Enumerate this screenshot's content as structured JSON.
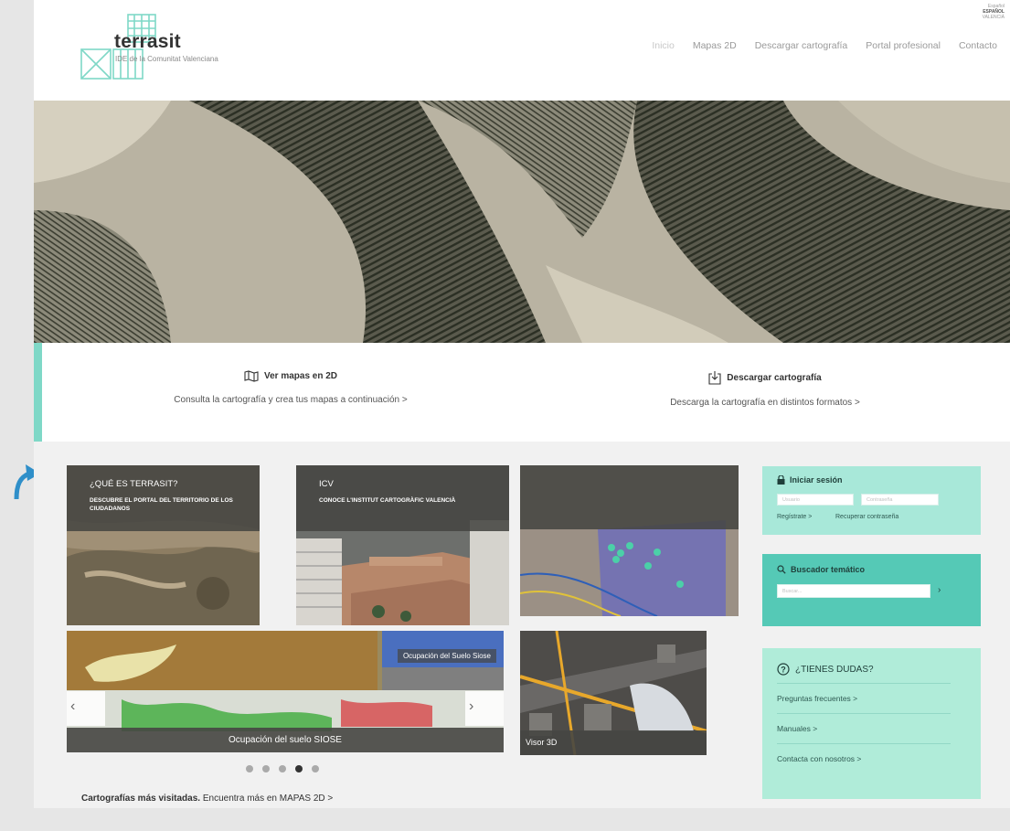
{
  "lang": {
    "l1": "Español",
    "l2": "ESPAÑOL",
    "l3": "VALENCIÀ"
  },
  "logo": {
    "name": "terrasit",
    "sub": "IDE de la Comunitat Valenciana"
  },
  "nav": [
    "Inicio",
    "Mapas 2D",
    "Descargar cartografía",
    "Portal profesional",
    "Contacto"
  ],
  "quick": {
    "maps_title": "Ver mapas en 2D",
    "maps_desc": "Consulta la cartografía y crea tus mapas a continuación >",
    "dl_title": "Descargar cartografía",
    "dl_desc": "Descarga la cartografía en distintos formatos >"
  },
  "tiles": {
    "t1_head": "¿QUÉ ES TERRASIT?",
    "t1_sub": "DESCUBRE EL PORTAL DEL TERRITORIO DE LOS CIUDADANOS",
    "t2_head": "ICV",
    "t2_sub": "CONOCE L'INSTITUT CARTOGRÀFIC VALENCIÀ",
    "carousel_label": "Ocupación del Suelo Siose",
    "carousel_caption": "Ocupación del suelo SIOSE",
    "visor3d": "Visor 3D"
  },
  "dots": {
    "count": 5,
    "active_index": 3
  },
  "bottom": {
    "bold": "Cartografías más visitadas.",
    "rest": " Encuentra más en MAPAS 2D >"
  },
  "login": {
    "title": "Iniciar sesión",
    "user_placeholder": "Usuario",
    "pass_placeholder": "Contraseña",
    "register": "Regístrate >",
    "recover": "Recuperar contraseña"
  },
  "search": {
    "title": "Buscador temático",
    "placeholder": "Buscar..."
  },
  "help": {
    "title": "¿TIENES DUDAS?",
    "items": [
      "Preguntas frecuentes >",
      "Manuales >",
      "Contacta con nosotros >"
    ]
  },
  "colors": {
    "accent": "#55c9b6",
    "accent_light": "#a8e8d9",
    "logo": "#7fd8c7",
    "caption": "#46463f"
  }
}
